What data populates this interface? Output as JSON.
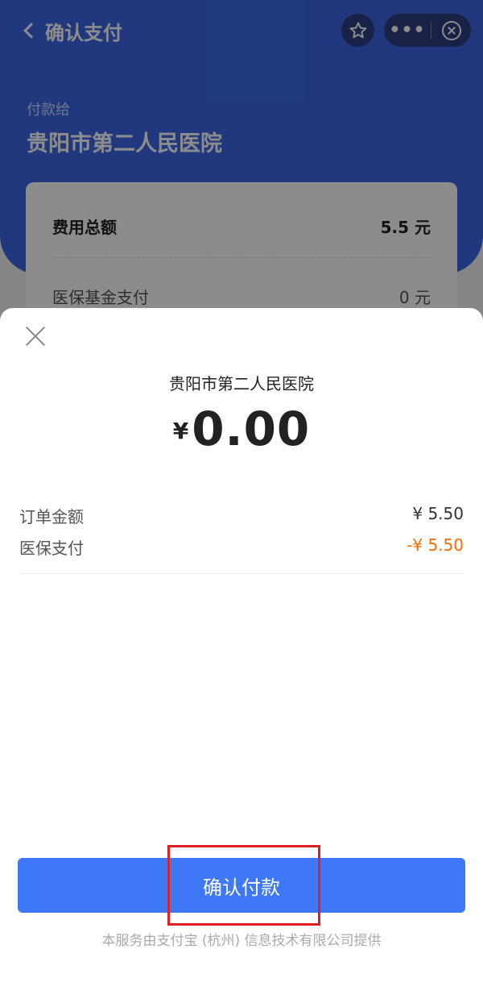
{
  "nav": {
    "title": "确认支付",
    "more_label": "•••"
  },
  "background": {
    "pay_to_label": "付款给",
    "merchant_name": "贵阳市第二人民医院",
    "rows": [
      {
        "label": "费用总额",
        "value": "5.5 元"
      },
      {
        "label": "医保基金支付",
        "value": "0 元"
      }
    ]
  },
  "sheet": {
    "merchant_name": "贵阳市第二人民医院",
    "currency_symbol": "¥",
    "amount": "0.00",
    "details": [
      {
        "label": "订单金额",
        "value": "¥ 5.50"
      },
      {
        "label": "医保支付",
        "value": "-¥ 5.50"
      }
    ],
    "confirm_label": "确认付款",
    "footer_note": "本服务由支付宝 (杭州) 信息技术有限公司提供"
  },
  "colors": {
    "header_blue": "#3c67e6",
    "button_blue": "#3f78f6",
    "discount_orange": "#ff6a00",
    "highlight_red": "#e02020"
  },
  "icons": [
    "back-chevron-icon",
    "star-icon",
    "more-icon",
    "close-circle-icon",
    "close-icon"
  ]
}
